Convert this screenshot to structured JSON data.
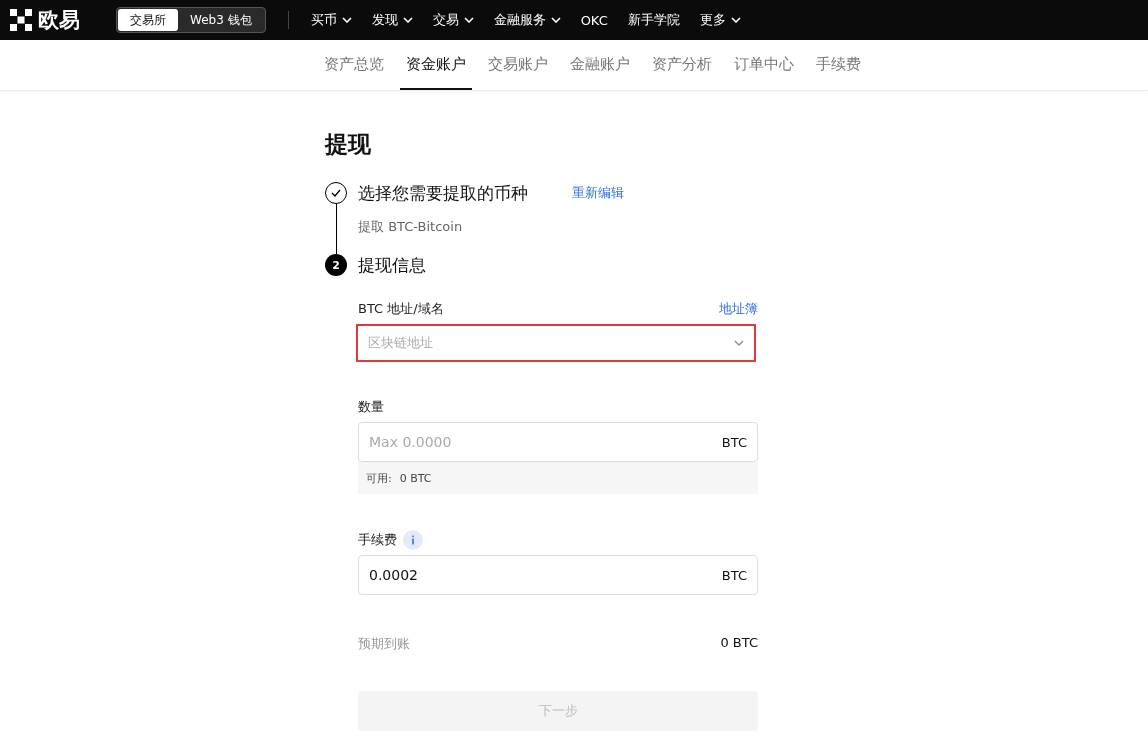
{
  "header": {
    "logo": "欧易",
    "switch": [
      {
        "label": "交易所",
        "selected": true
      },
      {
        "label": "Web3 钱包",
        "selected": false
      }
    ],
    "nav": [
      {
        "label": "买币",
        "has_menu": true
      },
      {
        "label": "发现",
        "has_menu": true
      },
      {
        "label": "交易",
        "has_menu": true
      },
      {
        "label": "金融服务",
        "has_menu": true
      },
      {
        "label": "OKC",
        "has_menu": false
      },
      {
        "label": "新手学院",
        "has_menu": false
      },
      {
        "label": "更多",
        "has_menu": true
      }
    ]
  },
  "tabs": [
    {
      "label": "资产总览",
      "selected": false
    },
    {
      "label": "资金账户",
      "selected": true
    },
    {
      "label": "交易账户",
      "selected": false
    },
    {
      "label": "金融账户",
      "selected": false
    },
    {
      "label": "资产分析",
      "selected": false
    },
    {
      "label": "订单中心",
      "selected": false
    },
    {
      "label": "手续费",
      "selected": false
    }
  ],
  "title": "提现",
  "steps": [
    {
      "done": true,
      "title": "选择您需要提取的币种",
      "action": "重新编辑",
      "summary": "提取 BTC-Bitcoin"
    },
    {
      "marker": "2",
      "done": false,
      "title": "提现信息"
    }
  ],
  "address": {
    "label": "BTC 地址/域名",
    "link": "地址簿",
    "placeholder": "区块链地址",
    "highlighted": true
  },
  "amount": {
    "label": "数量",
    "placeholder": "Max 0.0000",
    "unit": "BTC",
    "available_label": "可用:",
    "available": "0 BTC"
  },
  "fee": {
    "label": "手续费",
    "value": "0.0002",
    "unit": "BTC"
  },
  "expected": {
    "label": "预期到账",
    "value": "0 BTC"
  },
  "next_button": {
    "label": "下一步",
    "disabled": true
  }
}
